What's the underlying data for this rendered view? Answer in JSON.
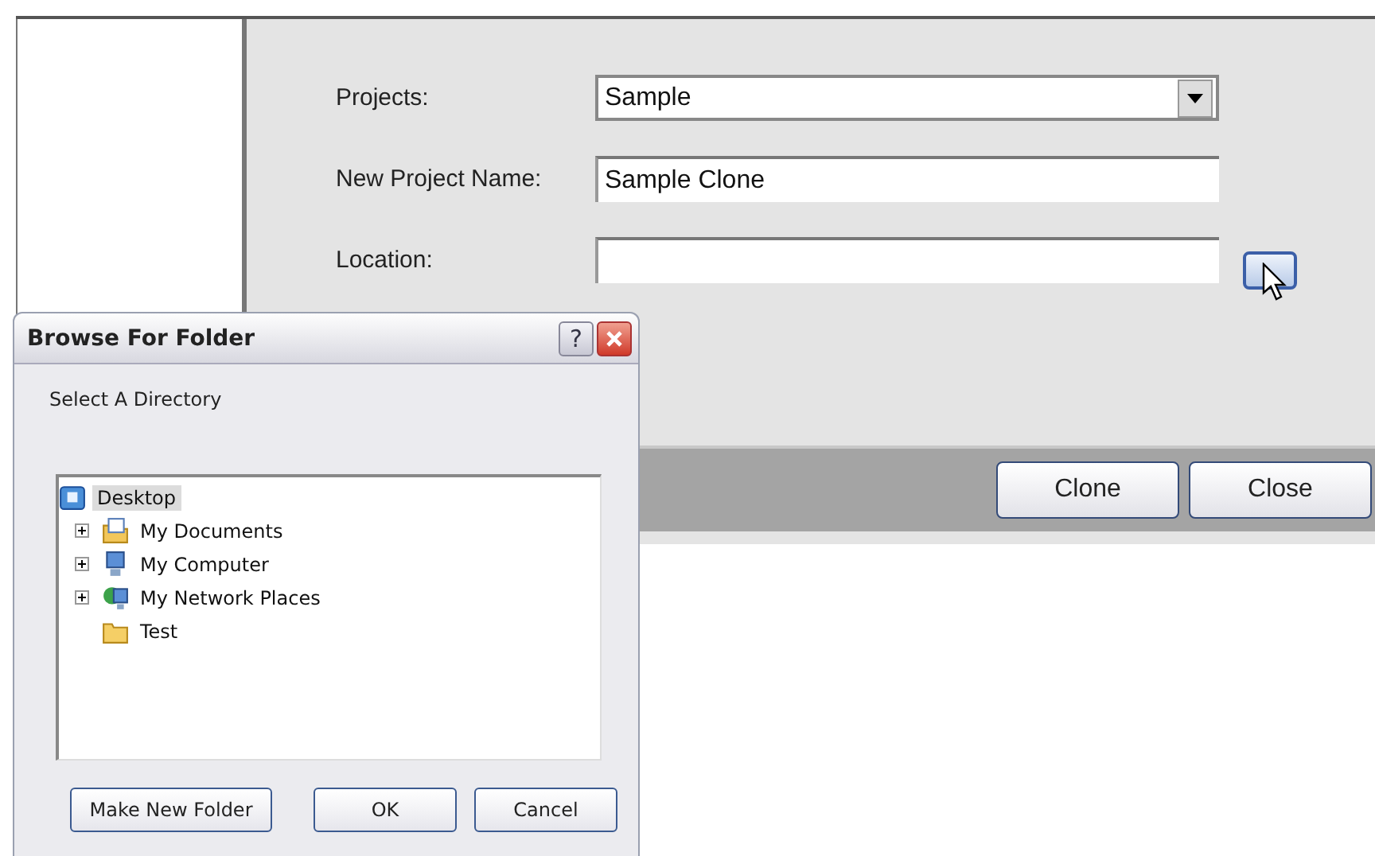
{
  "clone_dialog": {
    "fields": [
      {
        "label": "Projects:",
        "kind": "dropdown",
        "value": "Sample"
      },
      {
        "label": "New Project Name:",
        "kind": "text",
        "value": "Sample Clone"
      },
      {
        "label": "Location:",
        "kind": "browse"
      }
    ],
    "buttons": [
      "Clone",
      "Close"
    ]
  },
  "browse_dialog": {
    "title": "Browse For Folder",
    "help_button": "?",
    "prompt": "Select A Directory",
    "tree": [
      {
        "label": "Desktop",
        "kind": "desktop",
        "selected": true,
        "children": [
          {
            "label": "My Documents",
            "kind": "documents",
            "selected": false,
            "expanded": false
          },
          {
            "label": "My Computer",
            "kind": "computer",
            "selected": false,
            "expanded": false
          },
          {
            "label": "My Network Places",
            "kind": "network",
            "selected": false,
            "expanded": false
          },
          {
            "label": "Test",
            "kind": "folder",
            "selected": false
          }
        ]
      }
    ],
    "buttons": [
      "Make New Folder",
      "OK",
      "Cancel"
    ]
  }
}
